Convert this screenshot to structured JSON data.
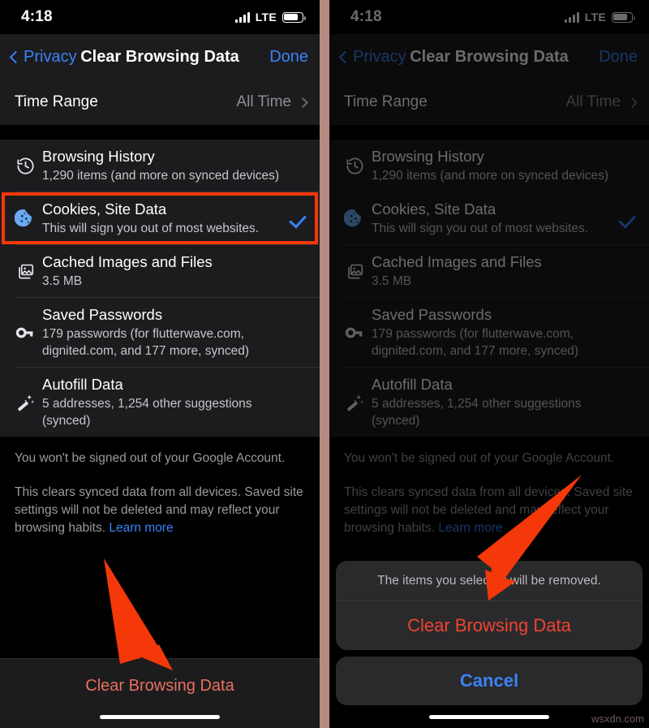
{
  "status_bar": {
    "time": "4:18",
    "carrier": "LTE",
    "signal_icon": "signal-bars-icon",
    "battery_icon": "battery-icon"
  },
  "nav": {
    "back_label": "Privacy",
    "back_icon": "chevron-left-icon",
    "title": "Clear Browsing Data",
    "done_label": "Done"
  },
  "time_range": {
    "label": "Time Range",
    "value": "All Time",
    "chevron_icon": "chevron-right-icon"
  },
  "items": [
    {
      "icon": "history-clock-icon",
      "title": "Browsing History",
      "subtitle": "1,290 items (and more on synced devices)",
      "checked": false,
      "highlighted": false
    },
    {
      "icon": "cookie-icon",
      "title": "Cookies, Site Data",
      "subtitle": "This will sign you out of most websites.",
      "checked": true,
      "highlighted": true
    },
    {
      "icon": "cached-images-icon",
      "title": "Cached Images and Files",
      "subtitle": "3.5 MB",
      "checked": false,
      "highlighted": false
    },
    {
      "icon": "key-icon",
      "title": "Saved Passwords",
      "subtitle": "179 passwords (for flutterwave.com, dignited.com, and 177 more, synced)",
      "checked": false,
      "highlighted": false
    },
    {
      "icon": "magic-wand-icon",
      "title": "Autofill Data",
      "subtitle": "5 addresses, 1,254 other suggestions (synced)",
      "checked": false,
      "highlighted": false
    }
  ],
  "footnote": {
    "line1": "You won't be signed out of your Google Account.",
    "line2": "This clears synced data from all devices. Saved site settings will not be deleted and may reflect your browsing habits.",
    "link": "Learn more"
  },
  "bottom_button": {
    "label": "Clear Browsing Data"
  },
  "action_sheet": {
    "message": "The items you selected will be removed.",
    "confirm_label": "Clear Browsing Data",
    "cancel_label": "Cancel"
  },
  "annotations": {
    "arrow_color": "#f4380a",
    "highlight_color": "#f4380a",
    "left_arrow": "arrow-pointing-to-clear-browsing-data-button",
    "right_arrow": "arrow-pointing-to-confirm-clear-browsing-data"
  },
  "watermark": "wsxdn.com",
  "colors": {
    "accent_blue": "#3b82f6",
    "destructive_red": "#ef4430",
    "background": "#000000",
    "card": "#1c1c1e"
  }
}
